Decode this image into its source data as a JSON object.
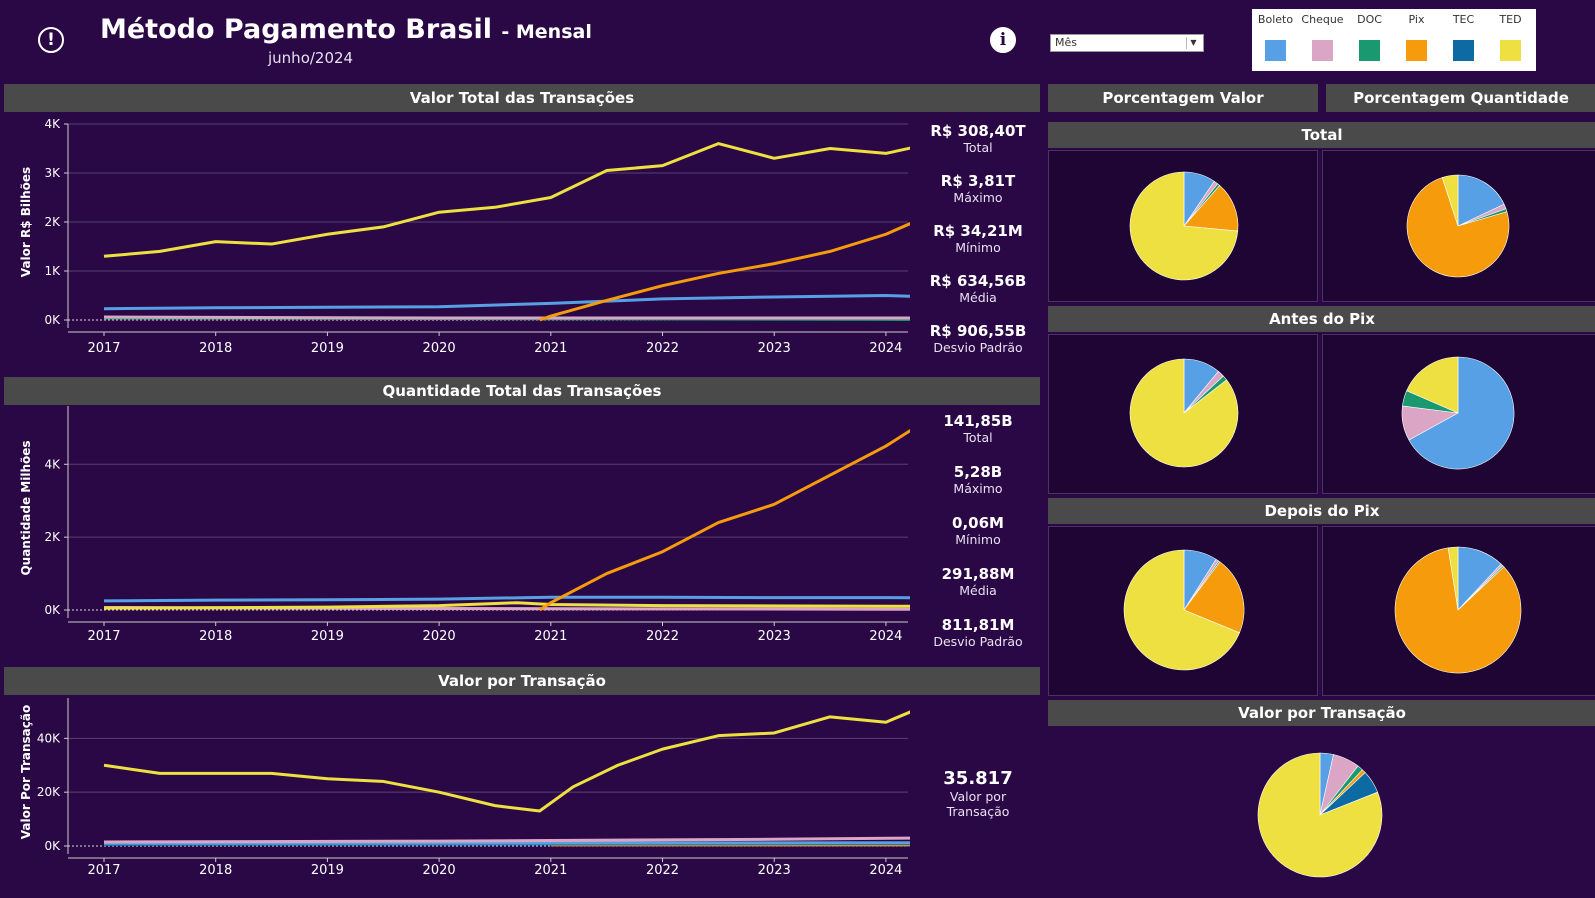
{
  "header": {
    "title": "Método Pagamento Brasil",
    "subtitle": "- Mensal",
    "period": "junho/2024",
    "alert_icon": "alert-icon",
    "info_icon": "info-icon"
  },
  "filter": {
    "selected": "Mês"
  },
  "legend": [
    {
      "name": "Boleto",
      "color": "#57a0e6"
    },
    {
      "name": "Cheque",
      "color": "#dba5c6"
    },
    {
      "name": "DOC",
      "color": "#1a9971"
    },
    {
      "name": "Pix",
      "color": "#f59b0c"
    },
    {
      "name": "TEC",
      "color": "#0e6aa3"
    },
    {
      "name": "TED",
      "color": "#eee041"
    }
  ],
  "sections": {
    "valor_total": "Valor Total das Transações",
    "quantidade_total": "Quantidade Total das Transações",
    "valor_por_transacao": "Valor por Transação",
    "pct_valor": "Porcentagem Valor",
    "pct_quantidade": "Porcentagem Quantidade",
    "total": "Total",
    "antes_pix": "Antes do Pix",
    "depois_pix": "Depois do Pix",
    "valor_por_transacao_pie": "Valor por Transação"
  },
  "stats_valor": [
    {
      "value": "R$ 308,40T",
      "label": "Total"
    },
    {
      "value": "R$ 3,81T",
      "label": "Máximo"
    },
    {
      "value": "R$ 34,21M",
      "label": "Mínimo"
    },
    {
      "value": "R$ 634,56B",
      "label": "Média"
    },
    {
      "value": "R$ 906,55B",
      "label": "Desvio Padrão"
    }
  ],
  "stats_quantidade": [
    {
      "value": "141,85B",
      "label": "Total"
    },
    {
      "value": "5,28B",
      "label": "Máximo"
    },
    {
      "value": "0,06M",
      "label": "Mínimo"
    },
    {
      "value": "291,88M",
      "label": "Média"
    },
    {
      "value": "811,81M",
      "label": "Desvio Padrão"
    }
  ],
  "stats_vpt": {
    "value": "35.817",
    "label_line1": "Valor por",
    "label_line2": "Transação"
  },
  "chart_data": [
    {
      "id": "valor-total",
      "type": "line",
      "ylabel": "Valor R$ Bilhões",
      "xlabel": "",
      "x_ticks": [
        "2017",
        "2018",
        "2019",
        "2020",
        "2021",
        "2022",
        "2023",
        "2024"
      ],
      "y_ticks": [
        {
          "v": 0,
          "label": "0K"
        },
        {
          "v": 1000,
          "label": "1K"
        },
        {
          "v": 2000,
          "label": "2K"
        },
        {
          "v": 3000,
          "label": "3K"
        },
        {
          "v": 4000,
          "label": "4K"
        }
      ],
      "ylim": [
        0,
        4000
      ],
      "xlim": [
        2017.0,
        2024.4
      ],
      "series": [
        {
          "name": "TED",
          "color": "#eee041",
          "x": [
            2017.0,
            2017.5,
            2018.0,
            2018.5,
            2019.0,
            2019.5,
            2020.0,
            2020.5,
            2021.0,
            2021.5,
            2022.0,
            2022.5,
            2023.0,
            2023.5,
            2024.0,
            2024.4
          ],
          "y": [
            1300,
            1400,
            1600,
            1550,
            1750,
            1900,
            2200,
            2300,
            2500,
            3050,
            3150,
            3600,
            3300,
            3500,
            3400,
            3600
          ]
        },
        {
          "name": "Pix",
          "color": "#f59b0c",
          "x": [
            2020.9,
            2021.0,
            2021.5,
            2022.0,
            2022.5,
            2023.0,
            2023.5,
            2024.0,
            2024.4
          ],
          "y": [
            0,
            80,
            400,
            700,
            950,
            1150,
            1400,
            1750,
            2150
          ]
        },
        {
          "name": "Boleto",
          "color": "#57a0e6",
          "x": [
            2017.0,
            2018.0,
            2019.0,
            2020.0,
            2021.0,
            2022.0,
            2023.0,
            2024.0,
            2024.4
          ],
          "y": [
            230,
            250,
            260,
            270,
            340,
            430,
            470,
            500,
            470
          ]
        },
        {
          "name": "Cheque",
          "color": "#dba5c6",
          "x": [
            2017.0,
            2020.0,
            2024.4
          ],
          "y": [
            60,
            40,
            40
          ]
        },
        {
          "name": "DOC",
          "color": "#1a9971",
          "x": [
            2017.0,
            2020.0,
            2024.4
          ],
          "y": [
            40,
            30,
            10
          ]
        }
      ]
    },
    {
      "id": "quantidade-total",
      "type": "line",
      "ylabel": "Quantidade Milhões",
      "xlabel": "",
      "x_ticks": [
        "2017",
        "2018",
        "2019",
        "2020",
        "2021",
        "2022",
        "2023",
        "2024"
      ],
      "y_ticks": [
        {
          "v": 0,
          "label": "0K"
        },
        {
          "v": 2000,
          "label": "2K"
        },
        {
          "v": 4000,
          "label": "4K"
        }
      ],
      "ylim": [
        0,
        5600
      ],
      "xlim": [
        2017.0,
        2024.4
      ],
      "series": [
        {
          "name": "Pix",
          "color": "#f59b0c",
          "x": [
            2020.9,
            2021.0,
            2021.5,
            2022.0,
            2022.5,
            2023.0,
            2023.5,
            2024.0,
            2024.4
          ],
          "y": [
            0,
            200,
            1000,
            1600,
            2400,
            2900,
            3700,
            4500,
            5280
          ]
        },
        {
          "name": "Boleto",
          "color": "#57a0e6",
          "x": [
            2017.0,
            2018.0,
            2019.0,
            2020.0,
            2021.0,
            2022.0,
            2023.0,
            2024.0,
            2024.4
          ],
          "y": [
            250,
            270,
            280,
            300,
            350,
            350,
            340,
            340,
            330
          ]
        },
        {
          "name": "TED",
          "color": "#eee041",
          "x": [
            2017.0,
            2019.0,
            2020.0,
            2020.7,
            2021.0,
            2022.0,
            2024.4
          ],
          "y": [
            50,
            80,
            120,
            200,
            150,
            120,
            100
          ]
        },
        {
          "name": "Cheque",
          "color": "#dba5c6",
          "x": [
            2017.0,
            2020.0,
            2024.4
          ],
          "y": [
            70,
            40,
            20
          ]
        }
      ]
    },
    {
      "id": "valor-por-transacao",
      "type": "line",
      "ylabel": "Valor Por Transação",
      "xlabel": "",
      "x_ticks": [
        "2017",
        "2018",
        "2019",
        "2020",
        "2021",
        "2022",
        "2023",
        "2024"
      ],
      "y_ticks": [
        {
          "v": 0,
          "label": "0K"
        },
        {
          "v": 20000,
          "label": "20K"
        },
        {
          "v": 40000,
          "label": "40K"
        }
      ],
      "ylim": [
        0,
        55000
      ],
      "xlim": [
        2017.0,
        2024.4
      ],
      "series": [
        {
          "name": "TED",
          "color": "#eee041",
          "x": [
            2017.0,
            2017.5,
            2018.0,
            2018.5,
            2019.0,
            2019.5,
            2020.0,
            2020.5,
            2020.9,
            2021.2,
            2021.6,
            2022.0,
            2022.5,
            2023.0,
            2023.5,
            2024.0,
            2024.4
          ],
          "y": [
            30000,
            27000,
            27000,
            27000,
            25000,
            24000,
            20000,
            15000,
            13000,
            22000,
            30000,
            36000,
            41000,
            42000,
            48000,
            46000,
            53000
          ]
        },
        {
          "name": "Cheque",
          "color": "#dba5c6",
          "x": [
            2017.0,
            2020.0,
            2023.0,
            2024.4
          ],
          "y": [
            1500,
            1800,
            2500,
            3000
          ]
        },
        {
          "name": "Boleto",
          "color": "#57a0e6",
          "x": [
            2017.0,
            2024.4
          ],
          "y": [
            1000,
            1200
          ]
        },
        {
          "name": "TEC",
          "color": "#0e6aa3",
          "x": [
            2017.0,
            2024.4
          ],
          "y": [
            600,
            900
          ]
        },
        {
          "name": "Pix",
          "color": "#f59b0c",
          "x": [
            2021.0,
            2024.4
          ],
          "y": [
            400,
            400
          ]
        }
      ]
    },
    {
      "id": "pie-total-valor",
      "type": "pie",
      "slices": [
        {
          "name": "Boleto",
          "value": 9.5
        },
        {
          "name": "Cheque",
          "value": 1.2
        },
        {
          "name": "DOC",
          "value": 0.8
        },
        {
          "name": "Pix",
          "value": 15
        },
        {
          "name": "TED",
          "value": 73.5
        }
      ]
    },
    {
      "id": "pie-total-qtd",
      "type": "pie",
      "slices": [
        {
          "name": "Boleto",
          "value": 18
        },
        {
          "name": "Cheque",
          "value": 1.5
        },
        {
          "name": "DOC",
          "value": 1
        },
        {
          "name": "Pix",
          "value": 74.5
        },
        {
          "name": "TED",
          "value": 5
        }
      ]
    },
    {
      "id": "pie-antes-valor",
      "type": "pie",
      "slices": [
        {
          "name": "Boleto",
          "value": 11
        },
        {
          "name": "Cheque",
          "value": 2
        },
        {
          "name": "DOC",
          "value": 1.5
        },
        {
          "name": "TED",
          "value": 85.5
        }
      ]
    },
    {
      "id": "pie-antes-qtd",
      "type": "pie",
      "slices": [
        {
          "name": "Boleto",
          "value": 67
        },
        {
          "name": "Cheque",
          "value": 10
        },
        {
          "name": "DOC",
          "value": 4.5
        },
        {
          "name": "TED",
          "value": 18.5
        }
      ]
    },
    {
      "id": "pie-depois-valor",
      "type": "pie",
      "slices": [
        {
          "name": "Boleto",
          "value": 9
        },
        {
          "name": "Cheque",
          "value": 0.8
        },
        {
          "name": "DOC",
          "value": 0.4
        },
        {
          "name": "Pix",
          "value": 21
        },
        {
          "name": "TED",
          "value": 68.8
        }
      ]
    },
    {
      "id": "pie-depois-qtd",
      "type": "pie",
      "slices": [
        {
          "name": "Boleto",
          "value": 12
        },
        {
          "name": "Cheque",
          "value": 0.6
        },
        {
          "name": "DOC",
          "value": 0.4
        },
        {
          "name": "Pix",
          "value": 84.5
        },
        {
          "name": "TED",
          "value": 2.5
        }
      ]
    },
    {
      "id": "pie-vpt",
      "type": "pie",
      "slices": [
        {
          "name": "Boleto",
          "value": 3.5
        },
        {
          "name": "Cheque",
          "value": 7
        },
        {
          "name": "DOC",
          "value": 1.5
        },
        {
          "name": "Pix",
          "value": 1
        },
        {
          "name": "TEC",
          "value": 6
        },
        {
          "name": "TED",
          "value": 81
        }
      ]
    }
  ]
}
